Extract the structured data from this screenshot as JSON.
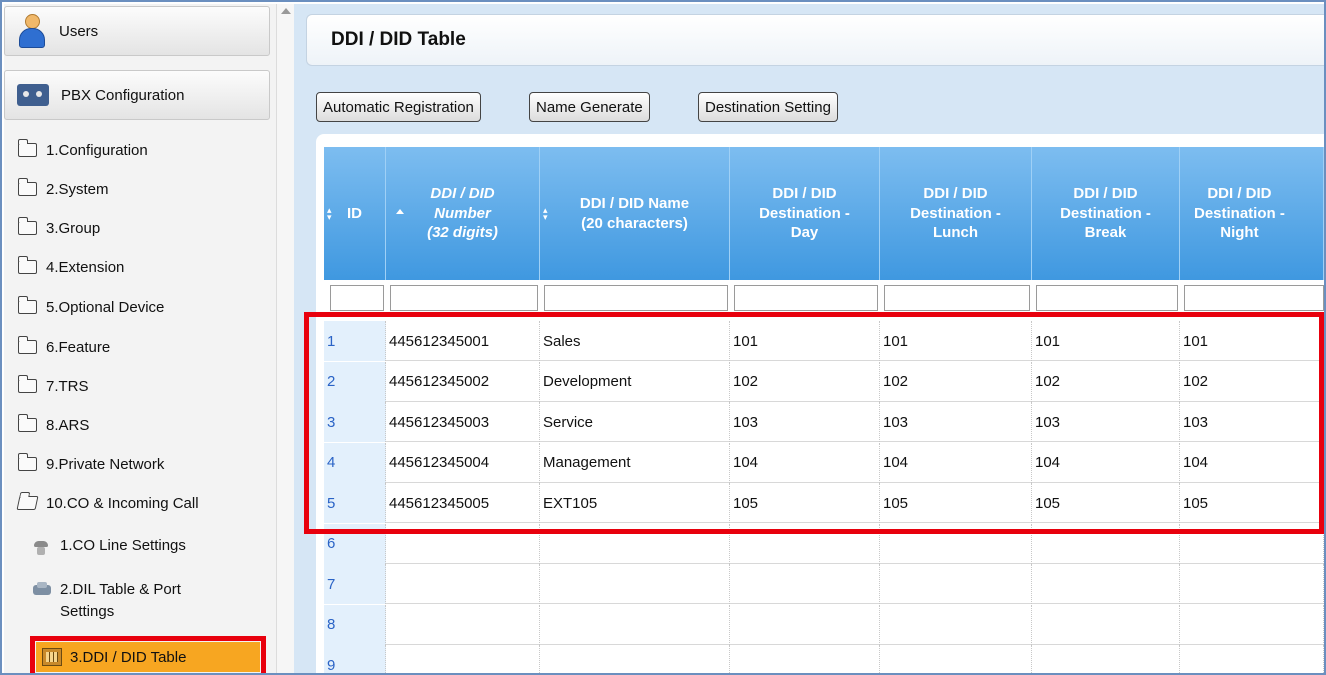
{
  "sidebar": {
    "sections": [
      {
        "label": "Users",
        "icon": "users-icon"
      },
      {
        "label": "PBX Configuration",
        "icon": "pbx-icon"
      }
    ],
    "tree": [
      {
        "label": "1.Configuration"
      },
      {
        "label": "2.System"
      },
      {
        "label": "3.Group"
      },
      {
        "label": "4.Extension"
      },
      {
        "label": "5.Optional Device"
      },
      {
        "label": "6.Feature"
      },
      {
        "label": "7.TRS"
      },
      {
        "label": "8.ARS"
      },
      {
        "label": "9.Private Network"
      },
      {
        "label": "10.CO & Incoming Call"
      }
    ],
    "sub_items": [
      {
        "label": "1.CO Line Settings"
      },
      {
        "label_line1": "2.DIL Table & Port",
        "label_line2": "Settings"
      },
      {
        "label": "3.DDI / DID Table",
        "active": true
      }
    ]
  },
  "page": {
    "title": "DDI / DID Table",
    "buttons": [
      "Automatic Registration",
      "Name Generate",
      "Destination Setting"
    ]
  },
  "table": {
    "columns": [
      {
        "line1": "ID"
      },
      {
        "line1": "DDI / DID",
        "line2": "Number",
        "line3": "(32 digits)"
      },
      {
        "line1": "DDI / DID Name",
        "line2": "(20 characters)"
      },
      {
        "line1": "DDI / DID",
        "line2": "Destination -",
        "line3": "Day"
      },
      {
        "line1": "DDI / DID",
        "line2": "Destination -",
        "line3": "Lunch"
      },
      {
        "line1": "DDI / DID",
        "line2": "Destination -",
        "line3": "Break"
      },
      {
        "line1": "DDI / DID",
        "line2": "Destination -",
        "line3": "Night"
      }
    ],
    "rows": [
      [
        "1",
        "445612345001",
        "Sales",
        "101",
        "101",
        "101",
        "101"
      ],
      [
        "2",
        "445612345002",
        "Development",
        "102",
        "102",
        "102",
        "102"
      ],
      [
        "3",
        "445612345003",
        "Service",
        "103",
        "103",
        "103",
        "103"
      ],
      [
        "4",
        "445612345004",
        "Management",
        "104",
        "104",
        "104",
        "104"
      ],
      [
        "5",
        "445612345005",
        "EXT105",
        "105",
        "105",
        "105",
        "105"
      ],
      [
        "6",
        "",
        "",
        "",
        "",
        "",
        ""
      ],
      [
        "7",
        "",
        "",
        "",
        "",
        "",
        ""
      ],
      [
        "8",
        "",
        "",
        "",
        "",
        "",
        ""
      ],
      [
        "9",
        "",
        "",
        "",
        "",
        "",
        ""
      ]
    ]
  },
  "colors": {
    "header_gradient_top": "#7dbdf0",
    "header_gradient_bottom": "#3f98e0",
    "active_item": "#f7a621",
    "highlight_box": "#e8000d",
    "id_text": "#2a63c6"
  }
}
